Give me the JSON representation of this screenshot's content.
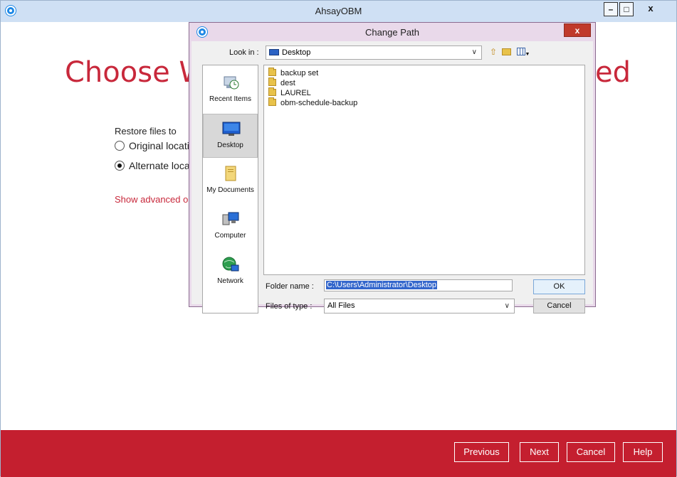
{
  "app": {
    "title": "AhsayOBM",
    "heading_left": "Choose W",
    "heading_right": "ed",
    "restore_label": "Restore files to",
    "options": [
      {
        "label": "Original locati",
        "selected": false
      },
      {
        "label": "Alternate loca",
        "selected": true
      }
    ],
    "advanced_link": "Show advanced o",
    "window_controls": {
      "minimize": "–",
      "maximize": "□",
      "close": "x"
    },
    "accent_color": "#c41f2f"
  },
  "footer": {
    "buttons": [
      "Previous",
      "Next",
      "Cancel",
      "Help"
    ]
  },
  "dialog": {
    "title": "Change Path",
    "close_label": "x",
    "look_in_label": "Look in :",
    "look_in_value": "Desktop",
    "places": [
      {
        "label": "Recent Items",
        "icon": "recent-items-icon",
        "selected": false
      },
      {
        "label": "Desktop",
        "icon": "desktop-icon",
        "selected": true
      },
      {
        "label": "My Documents",
        "icon": "documents-icon",
        "selected": false
      },
      {
        "label": "Computer",
        "icon": "computer-icon",
        "selected": false
      },
      {
        "label": "Network",
        "icon": "network-icon",
        "selected": false
      }
    ],
    "files": [
      "backup set",
      "dest",
      "LAUREL",
      "obm-schedule-backup"
    ],
    "folder_name_label": "Folder name :",
    "folder_name_value": "C:\\Users\\Administrator\\Desktop",
    "files_of_type_label": "Files of type :",
    "files_of_type_value": "All Files",
    "ok_label": "OK",
    "cancel_label": "Cancel"
  }
}
